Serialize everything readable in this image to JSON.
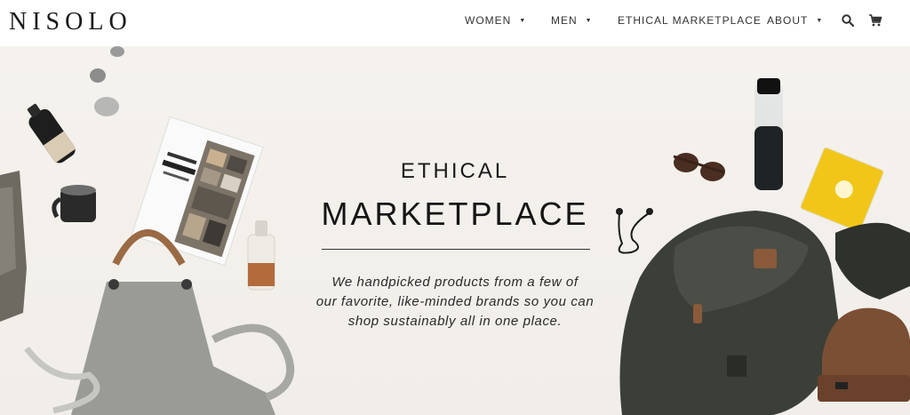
{
  "header": {
    "logo": "NISOLO",
    "nav": [
      {
        "label": "WOMEN",
        "has_dropdown": true
      },
      {
        "label": "MEN",
        "has_dropdown": true
      },
      {
        "label": "ETHICAL MARKETPLACE",
        "has_dropdown": false
      },
      {
        "label": "ABOUT",
        "has_dropdown": true
      }
    ],
    "icons": [
      "search-icon",
      "cart-icon"
    ]
  },
  "hero": {
    "title_small": "ETHICAL",
    "title_big": "MARKETPLACE",
    "tagline_lines": [
      "We handpicked products from a few of",
      "our favorite, like-minded brands so you can",
      "shop sustainably all in one place."
    ]
  },
  "colors": {
    "background": "#f3f0ec",
    "text": "#1b1b1b",
    "backpack": "#3b3f38",
    "notebook": "#f2c618",
    "leather": "#8a5a3b"
  }
}
